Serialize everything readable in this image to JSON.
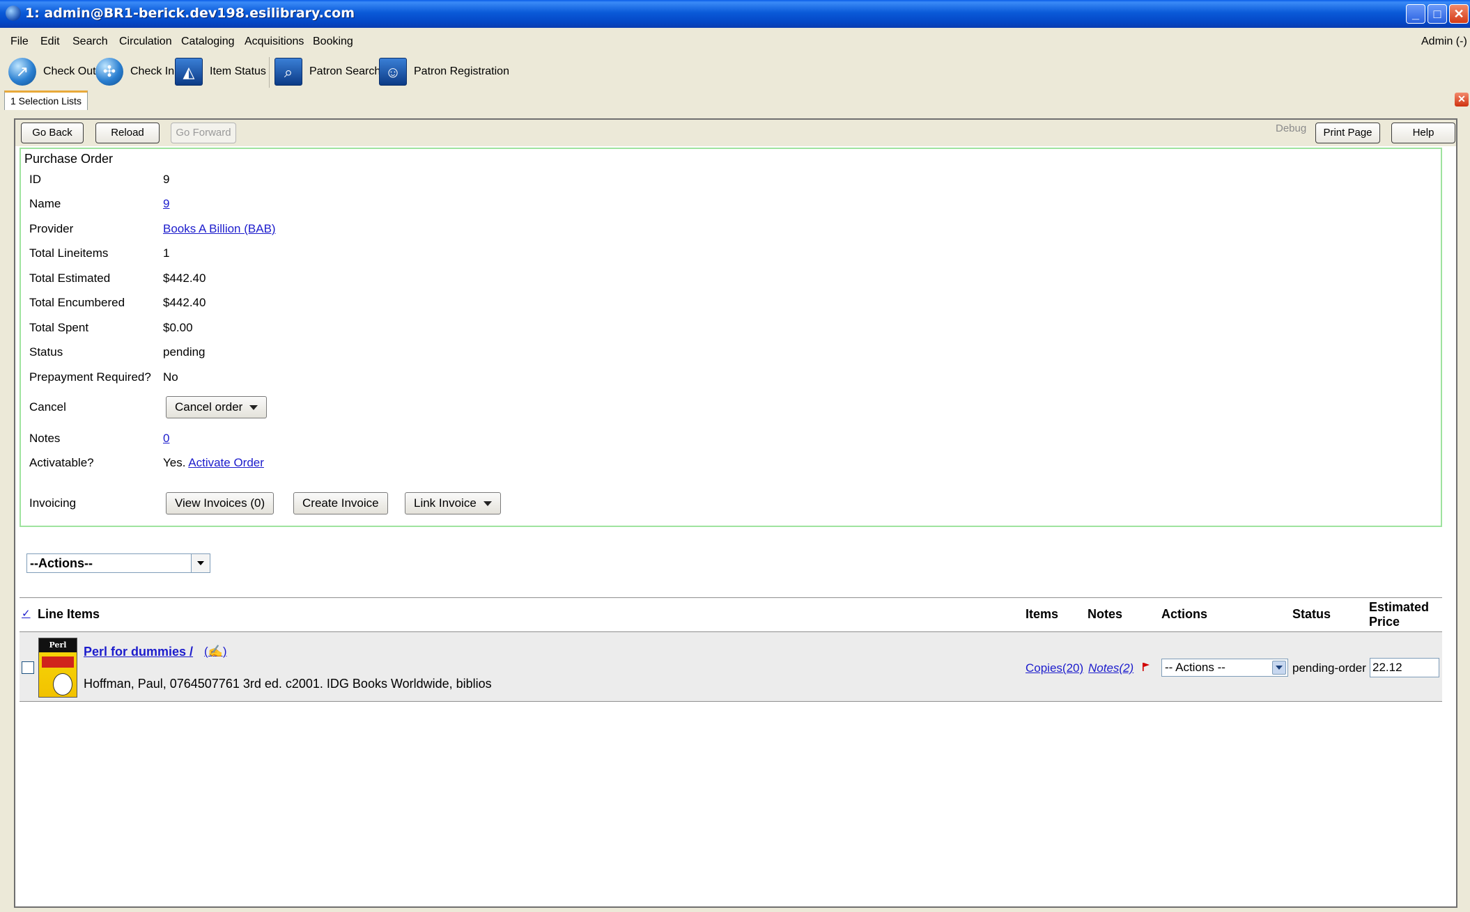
{
  "window": {
    "title": "1: admin@BR1-berick.dev198.esilibrary.com"
  },
  "menubar": {
    "items": [
      {
        "label": "File"
      },
      {
        "label": "Edit"
      },
      {
        "label": "Search"
      },
      {
        "label": "Circulation"
      },
      {
        "label": "Cataloging"
      },
      {
        "label": "Acquisitions"
      },
      {
        "label": "Booking"
      }
    ],
    "user": "Admin (-)"
  },
  "toolbar": {
    "check_out": "Check Out",
    "check_in": "Check In",
    "item_status": "Item Status",
    "patron_search": "Patron Search",
    "patron_registration": "Patron Registration"
  },
  "tab": {
    "label": "1 Selection Lists"
  },
  "nav": {
    "go_back": "Go Back",
    "reload": "Reload",
    "go_forward": "Go Forward",
    "debug": "Debug",
    "print_page": "Print Page",
    "help": "Help"
  },
  "po": {
    "heading": "Purchase Order",
    "rows": [
      {
        "label": "ID",
        "value": "9"
      },
      {
        "label": "Name",
        "value": "9"
      },
      {
        "label": "Provider",
        "value": "Books A Billion (BAB)"
      },
      {
        "label": "Total Lineitems",
        "value": "1"
      },
      {
        "label": "Total Estimated",
        "value": "$442.40"
      },
      {
        "label": "Total Encumbered",
        "value": "$442.40"
      },
      {
        "label": "Total Spent",
        "value": "$0.00"
      },
      {
        "label": "Status",
        "value": "pending"
      },
      {
        "label": "Prepayment Required?",
        "value": "No"
      }
    ],
    "cancel_label": "Cancel",
    "cancel_button": "Cancel order",
    "notes_label": "Notes",
    "notes_value": "0",
    "activatable_label": "Activatable?",
    "activatable_value": "Yes.",
    "activate_link": "Activate Order",
    "invoicing_label": "Invoicing",
    "view_invoices": "View Invoices (0)",
    "create_invoice": "Create Invoice",
    "link_invoice": "Link Invoice"
  },
  "actions_select": {
    "value": "--Actions--"
  },
  "line_items": {
    "headers": {
      "check": "✓",
      "line_items": "Line Items",
      "items": "Items",
      "notes": "Notes",
      "actions": "Actions",
      "status": "Status",
      "estimated_price": "Estimated Price"
    },
    "rows": [
      {
        "title": "Perl for dummies /",
        "edit_link": "(✍)",
        "details": "Hoffman, Paul, 0764507761 3rd ed. c2001. IDG Books Worldwide, biblios",
        "copies": "Copies(20)",
        "notes": "Notes(2)",
        "actions": "-- Actions --",
        "status": "pending-order",
        "price": "22.12",
        "cover_text": "Perl"
      }
    ]
  },
  "colors": {
    "title_bar": "#0a5ad8",
    "po_border": "#9ee39e",
    "link": "#1c1ccc",
    "flag": "#d00000"
  }
}
